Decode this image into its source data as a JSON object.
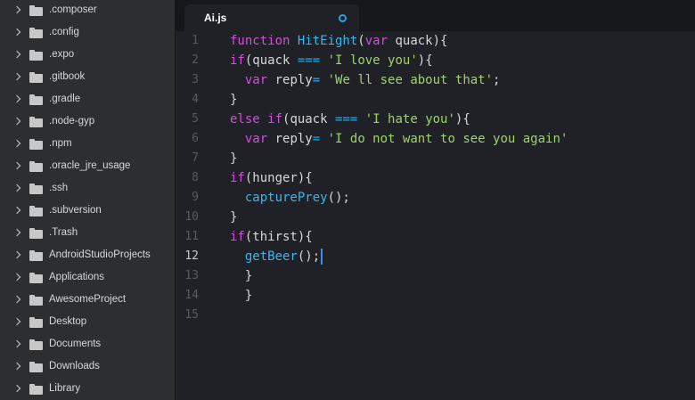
{
  "sidebar": {
    "items": [
      {
        "label": ".composer"
      },
      {
        "label": ".config"
      },
      {
        "label": ".expo"
      },
      {
        "label": ".gitbook"
      },
      {
        "label": ".gradle"
      },
      {
        "label": ".node-gyp"
      },
      {
        "label": ".npm"
      },
      {
        "label": ".oracle_jre_usage"
      },
      {
        "label": ".ssh"
      },
      {
        "label": ".subversion"
      },
      {
        "label": ".Trash"
      },
      {
        "label": "AndroidStudioProjects"
      },
      {
        "label": "Applications"
      },
      {
        "label": "AwesomeProject"
      },
      {
        "label": "Desktop"
      },
      {
        "label": "Documents"
      },
      {
        "label": "Downloads"
      },
      {
        "label": "Library"
      }
    ]
  },
  "tab": {
    "title": "Ai.js",
    "modified": true
  },
  "editor": {
    "active_line": 12,
    "line_numbers": [
      "1",
      "2",
      "3",
      "4",
      "5",
      "6",
      "7",
      "8",
      "9",
      "10",
      "11",
      "12",
      "13",
      "14",
      "15"
    ],
    "lines": [
      [
        {
          "t": "kw",
          "v": "function "
        },
        {
          "t": "fn",
          "v": "HitEight"
        },
        {
          "t": "plain",
          "v": "("
        },
        {
          "t": "kw",
          "v": "var"
        },
        {
          "t": "plain",
          "v": " quack){"
        }
      ],
      [
        {
          "t": "kw",
          "v": "if"
        },
        {
          "t": "plain",
          "v": "(quack "
        },
        {
          "t": "op",
          "v": "==="
        },
        {
          "t": "plain",
          "v": " "
        },
        {
          "t": "str",
          "v": "'I love you'"
        },
        {
          "t": "plain",
          "v": "){"
        }
      ],
      [
        {
          "t": "plain",
          "v": "  "
        },
        {
          "t": "kw",
          "v": "var"
        },
        {
          "t": "plain",
          "v": " reply"
        },
        {
          "t": "op",
          "v": "="
        },
        {
          "t": "plain",
          "v": " "
        },
        {
          "t": "str",
          "v": "'We ll see about that'"
        },
        {
          "t": "plain",
          "v": ";"
        }
      ],
      [
        {
          "t": "plain",
          "v": "}"
        }
      ],
      [
        {
          "t": "kw",
          "v": "else if"
        },
        {
          "t": "plain",
          "v": "(quack "
        },
        {
          "t": "op",
          "v": "==="
        },
        {
          "t": "plain",
          "v": " "
        },
        {
          "t": "str",
          "v": "'I hate you'"
        },
        {
          "t": "plain",
          "v": "){"
        }
      ],
      [
        {
          "t": "plain",
          "v": "  "
        },
        {
          "t": "kw",
          "v": "var"
        },
        {
          "t": "plain",
          "v": " reply"
        },
        {
          "t": "op",
          "v": "="
        },
        {
          "t": "plain",
          "v": " "
        },
        {
          "t": "str",
          "v": "'I do not want to see you again'"
        }
      ],
      [
        {
          "t": "plain",
          "v": "}"
        }
      ],
      [
        {
          "t": "kw",
          "v": "if"
        },
        {
          "t": "plain",
          "v": "(hunger){"
        }
      ],
      [
        {
          "t": "plain",
          "v": "  "
        },
        {
          "t": "fn",
          "v": "capturePrey"
        },
        {
          "t": "plain",
          "v": "();"
        }
      ],
      [
        {
          "t": "plain",
          "v": "}"
        }
      ],
      [
        {
          "t": "kw",
          "v": "if"
        },
        {
          "t": "plain",
          "v": "(thirst){"
        }
      ],
      [
        {
          "t": "plain",
          "v": "  "
        },
        {
          "t": "fn",
          "v": "getBeer"
        },
        {
          "t": "plain",
          "v": "();"
        }
      ],
      [
        {
          "t": "plain",
          "v": "  }"
        }
      ],
      [
        {
          "t": "plain",
          "v": "  }"
        }
      ],
      []
    ]
  },
  "colors": {
    "keyword": "#d14fd8",
    "function": "#3cb6ec",
    "string": "#9fd36c",
    "operator": "#2fa8e2",
    "modified_dot": "#2aa3e6",
    "cursor": "#3f8ee8"
  },
  "icons": {
    "tree_chevron": "chevron-right-icon",
    "tree_folder": "folder-icon",
    "tab_modified": "modified-dot-icon"
  }
}
